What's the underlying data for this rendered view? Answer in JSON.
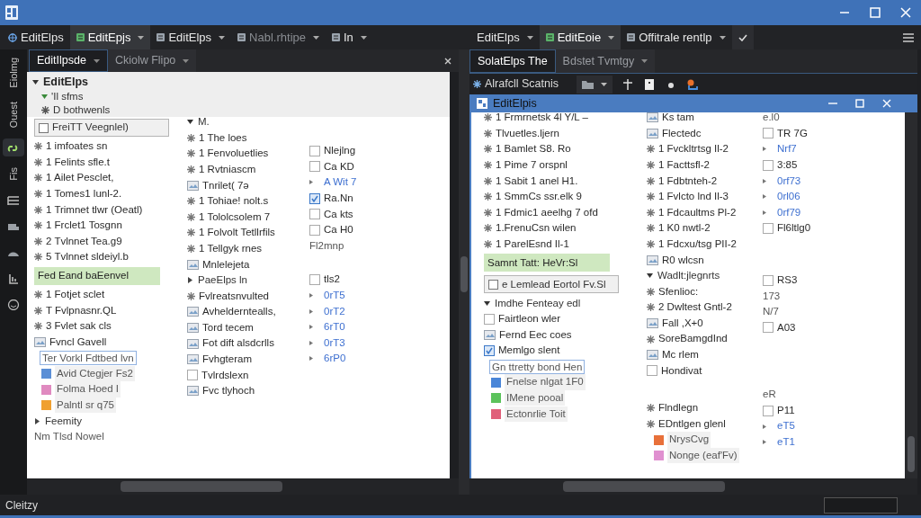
{
  "menu_left": [
    {
      "label": "EditElps",
      "selected": false,
      "dropdown": false,
      "disabled": false
    },
    {
      "label": "EditEpjs",
      "selected": true,
      "dropdown": true,
      "disabled": false
    },
    {
      "label": "EditElps",
      "selected": false,
      "dropdown": true,
      "disabled": false
    },
    {
      "label": "Nabl.rhtipe",
      "selected": false,
      "dropdown": true,
      "disabled": true
    },
    {
      "label": "In",
      "selected": false,
      "dropdown": true,
      "disabled": false
    }
  ],
  "menu_right": [
    {
      "label": "EditElps",
      "selected": false,
      "dropdown": true,
      "disabled": false
    },
    {
      "label": "EditEoie",
      "selected": true,
      "dropdown": true,
      "disabled": false
    },
    {
      "label": "Offitrale rentlp",
      "selected": false,
      "dropdown": true,
      "disabled": false
    }
  ],
  "activity_bar": [
    {
      "kind": "label",
      "label": "Eiolmg",
      "selected": false
    },
    {
      "kind": "label",
      "label": "Ouest",
      "selected": false
    },
    {
      "kind": "icon",
      "selected": true
    },
    {
      "kind": "label",
      "label": "Fis",
      "selected": false
    },
    {
      "kind": "icon",
      "selected": false
    },
    {
      "kind": "icon",
      "selected": false
    },
    {
      "kind": "icon",
      "selected": false
    },
    {
      "kind": "icon",
      "selected": false
    },
    {
      "kind": "icon",
      "selected": false
    }
  ],
  "left_pane": {
    "tabs": [
      {
        "label": "EditIlpsde",
        "selected": true
      },
      {
        "label": "Ckiolw Flipo",
        "selected": false
      }
    ],
    "tree": {
      "title": "EditElps",
      "children": [
        {
          "label": "'Il sfms"
        },
        {
          "label": "D bothwenls"
        }
      ]
    },
    "columns": [
      [
        [
          {
            "kind": "boxed",
            "label": "FreiTT Veegnlel)",
            "checked": false
          },
          {
            "kind": "row",
            "label": "1 imfoates sn"
          },
          {
            "kind": "row",
            "label": "1 Felints sfle.t"
          },
          {
            "kind": "row",
            "label": "1 Ailet Pesclet,"
          },
          {
            "kind": "row",
            "label": "1 Tomes1 lunl-2."
          },
          {
            "kind": "row",
            "label": "1 Trimnet tlwr (Oeatl)"
          },
          {
            "kind": "row",
            "label": "1 Frclet1 Tosgnn"
          },
          {
            "kind": "row",
            "label": "2 Tvlnnet Tea.g9"
          },
          {
            "kind": "row",
            "label": "5 Tvlnnet sldeiyl.b"
          },
          {
            "kind": "highlight",
            "label": "Fed Eand baEenvel"
          },
          {
            "kind": "row",
            "label": "1 Fotjet sclet"
          },
          {
            "kind": "row",
            "label": "T Fvlpnasnr.QL"
          },
          {
            "kind": "row",
            "label": "3 Fvlet sak cls"
          },
          {
            "kind": "icon_row",
            "label": "Fvncl Gavell"
          },
          {
            "kind": "framed",
            "label": "Ter Vorkl Fdtbed lvn"
          },
          {
            "kind": "swatch",
            "label": "Avid Ctegjer Fs2",
            "color": "#5b8fd6"
          },
          {
            "kind": "swatch",
            "label": "Folma Hoed I",
            "color": "#e08ac0"
          },
          {
            "kind": "swatch",
            "label": "Palntl sr q75",
            "color": "#f0a030"
          },
          {
            "kind": "group",
            "label": "Feemity",
            "expanded": false
          },
          {
            "kind": "plain",
            "label": "Nm Tlsd Nowel"
          }
        ]
      ],
      [
        [
          {
            "kind": "group",
            "label": "M.",
            "expanded": true
          },
          {
            "kind": "row",
            "label": "1 The loes"
          },
          {
            "kind": "row",
            "label": "1 Fenvoluetlies"
          },
          {
            "kind": "row",
            "label": "1 Rvtniascm"
          },
          {
            "kind": "icon_row",
            "label": "Tnrilet( 7ǝ"
          },
          {
            "kind": "row",
            "label": "1 Tohiae! nolt.s"
          },
          {
            "kind": "row",
            "label": "1 Tololcsolem 7"
          },
          {
            "kind": "row",
            "label": "1 Folvolt Tetllrfils"
          },
          {
            "kind": "row",
            "label": "1 Tellgyk rnes"
          },
          {
            "kind": "icon_row",
            "label": "Mnlelejeta"
          },
          {
            "kind": "group",
            "label": "PaeElps ln",
            "expanded": false
          },
          {
            "kind": "row",
            "label": "Fvlreatsnvulted"
          },
          {
            "kind": "icon_row",
            "label": "Avhelderntealls,"
          },
          {
            "kind": "icon_row",
            "label": "Tord tecem"
          },
          {
            "kind": "icon_row",
            "label": "Fot dift alsdcrlls"
          },
          {
            "kind": "icon_row",
            "label": "Fvhgteram"
          },
          {
            "kind": "check",
            "label": "Tvlrdslexn",
            "checked": false
          },
          {
            "kind": "icon_row",
            "label": "Fvc tlyhoch"
          }
        ]
      ],
      [
        [
          {
            "kind": "check",
            "label": "Nlejlng",
            "checked": false
          },
          {
            "kind": "check",
            "label": "Ca KD",
            "checked": false
          },
          {
            "kind": "link",
            "label": "A Wit 7"
          },
          {
            "kind": "check",
            "label": "Ra.Nn",
            "checked": true
          },
          {
            "kind": "check",
            "label": "Ca kts",
            "checked": false
          },
          {
            "kind": "check",
            "label": "Ca H0",
            "checked": false
          },
          {
            "kind": "plain",
            "label": "Fl2mnp"
          }
        ],
        [
          {
            "kind": "check",
            "label": "tls2",
            "checked": false
          },
          {
            "kind": "link",
            "label": "0rT5"
          },
          {
            "kind": "link",
            "label": "0rT2"
          },
          {
            "kind": "link",
            "label": "6rT0"
          },
          {
            "kind": "link",
            "label": "0rT3"
          },
          {
            "kind": "link",
            "label": "6rP0"
          }
        ]
      ]
    ]
  },
  "right_pane": {
    "tabs": [
      {
        "label": "SolatElps The",
        "selected": true
      },
      {
        "label": "Bdstet Tvmtgy",
        "selected": false
      }
    ],
    "toolbar_button": "Alrafcll Scatnis",
    "inner_window_title": "EditElpis",
    "columns": [
      [
        [
          {
            "kind": "row",
            "label": "1 Frmrnetsk 4l Y/L –"
          },
          {
            "kind": "row",
            "label": "Tlvuetles.ljern"
          },
          {
            "kind": "row",
            "label": "1 Bamlet S8. Ro"
          },
          {
            "kind": "row",
            "label": "1 Pime 7 orspnl"
          },
          {
            "kind": "row",
            "label": "1 Sabit 1 anel H1."
          },
          {
            "kind": "row",
            "label": "1 SmmCs ssr.elk 9"
          },
          {
            "kind": "row",
            "label": "1 Fdmic1 aeelhg 7 ofd"
          },
          {
            "kind": "row",
            "label": "1.FrenuCsn wilen"
          },
          {
            "kind": "row",
            "label": "1 ParelEsnd Il-1"
          },
          {
            "kind": "highlight",
            "label": "Samnt Tatt: HeVr:Sl"
          },
          {
            "kind": "boxed",
            "label": "e Lemlead Eortol Fv.Sl",
            "checked": false
          },
          {
            "kind": "group",
            "label": "Imdhe Fenteay edl",
            "expanded": true
          },
          {
            "kind": "check",
            "label": "Fairtleon wler",
            "checked": false
          },
          {
            "kind": "icon_row",
            "label": "Fernd Eec coes"
          },
          {
            "kind": "check",
            "label": "Memlgo slent",
            "checked": true
          },
          {
            "kind": "framed",
            "label": "Gn ttretty bond Hen"
          },
          {
            "kind": "swatch",
            "label": "Fnelse nlgat 1F0",
            "color": "#4a86d8"
          },
          {
            "kind": "swatch",
            "label": "IMene pooal",
            "color": "#5cc35c"
          },
          {
            "kind": "swatch",
            "label": "Ectonrlie Toit",
            "color": "#e0607a"
          }
        ]
      ],
      [
        [
          {
            "kind": "icon_row",
            "label": "Ks tam"
          },
          {
            "kind": "icon_row",
            "label": "Flectedc"
          },
          {
            "kind": "row",
            "label": "1 Fvckltrtsg Il-2"
          },
          {
            "kind": "row",
            "label": "1 Facttsfl-2"
          },
          {
            "kind": "row",
            "label": "1 Fdbtnteh-2"
          },
          {
            "kind": "row",
            "label": "1 Fvlcto lnd Il-3"
          },
          {
            "kind": "row",
            "label": "1 Fdcaultms Pl-2"
          },
          {
            "kind": "row",
            "label": "1 K0 nwtl-2"
          },
          {
            "kind": "row",
            "label": "1 Fdcxu/tsg PII-2"
          },
          {
            "kind": "icon_row",
            "label": "R0 wlcsn"
          },
          {
            "kind": "group",
            "label": "Wadlt:jlegnrts",
            "expanded": true
          },
          {
            "kind": "row",
            "label": "Sfenlioc:"
          },
          {
            "kind": "row",
            "label": "2 Dwltest Gntl-2"
          },
          {
            "kind": "icon_row",
            "label": "Fall ,X+0"
          },
          {
            "kind": "row",
            "label": "SoreBamgdInd"
          },
          {
            "kind": "icon_row",
            "label": "Mc rlem"
          },
          {
            "kind": "check",
            "label": "Hondivat",
            "checked": false
          }
        ],
        [
          {
            "kind": "row",
            "label": "Flndlegn"
          },
          {
            "kind": "row",
            "label": "EDntlgen glenl"
          },
          {
            "kind": "swatch",
            "label": "NrysCvg",
            "color": "#e8703a"
          },
          {
            "kind": "swatch",
            "label": "Nonge (eaf'Fv)",
            "color": "#e090d0"
          }
        ]
      ],
      [
        [
          {
            "kind": "plain",
            "label": "e.l0"
          },
          {
            "kind": "check",
            "label": "TR 7G",
            "checked": false
          },
          {
            "kind": "link",
            "label": "Nrf7"
          },
          {
            "kind": "check",
            "label": "3:85",
            "checked": false
          },
          {
            "kind": "link",
            "label": "0rf73"
          },
          {
            "kind": "link",
            "label": "0rl06"
          },
          {
            "kind": "link",
            "label": "0rf79"
          },
          {
            "kind": "check",
            "label": "Fl6ltlg0",
            "checked": false
          }
        ],
        [
          {
            "kind": "check",
            "label": "RS3",
            "checked": false
          },
          {
            "kind": "plain",
            "label": "173"
          },
          {
            "kind": "plain",
            "label": "N/7"
          },
          {
            "kind": "check",
            "label": "A03",
            "checked": false
          }
        ],
        [
          {
            "kind": "plain",
            "label": "eR"
          },
          {
            "kind": "check",
            "label": "P11",
            "checked": false
          },
          {
            "kind": "link",
            "label": "eT5"
          },
          {
            "kind": "link",
            "label": "eT1"
          }
        ]
      ]
    ]
  },
  "status_bar": {
    "text": "Cleitzy"
  }
}
